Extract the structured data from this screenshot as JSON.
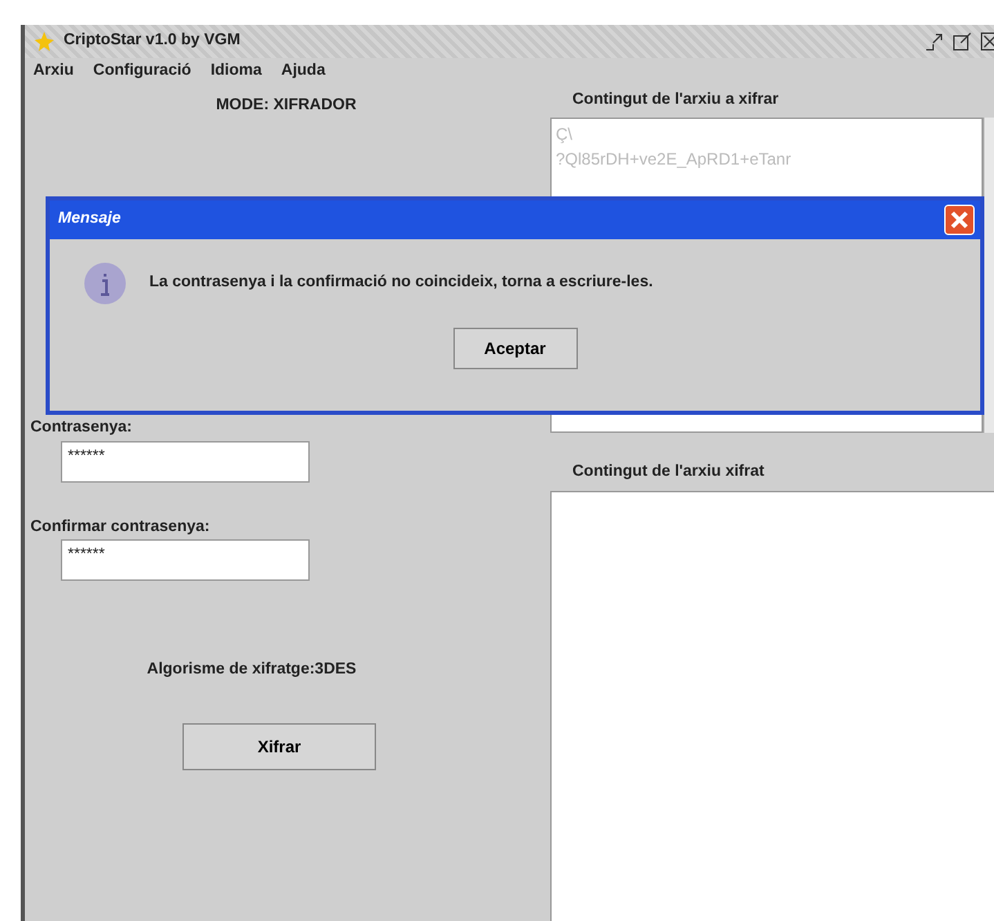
{
  "window": {
    "title": "CriptoStar v1.0 by VGM"
  },
  "menu": [
    "Arxiu",
    "Configuració",
    "Idioma",
    "Ajuda"
  ],
  "left_panel": {
    "mode": "MODE: XIFRADOR",
    "password_label": "Contrasenya:",
    "password_value": "******",
    "confirm_label": "Confirmar contrasenya:",
    "confirm_value": "******",
    "algorithm": "Algorisme de xifratge:3DES",
    "button": "Xifrar"
  },
  "source_panel": {
    "title": "Contingut de l'arxiu a xifrar",
    "lines": [
      "Ç\\",
      "?Ql85rDH+ve2E_ApRD1+eTanr"
    ]
  },
  "result_panel": {
    "title": "Contingut de l'arxiu  xifrat"
  },
  "dialog": {
    "title": "Mensaje",
    "message": "La contrasenya i la confirmació no coincideix, torna a escriure-les.",
    "button": "Aceptar"
  }
}
